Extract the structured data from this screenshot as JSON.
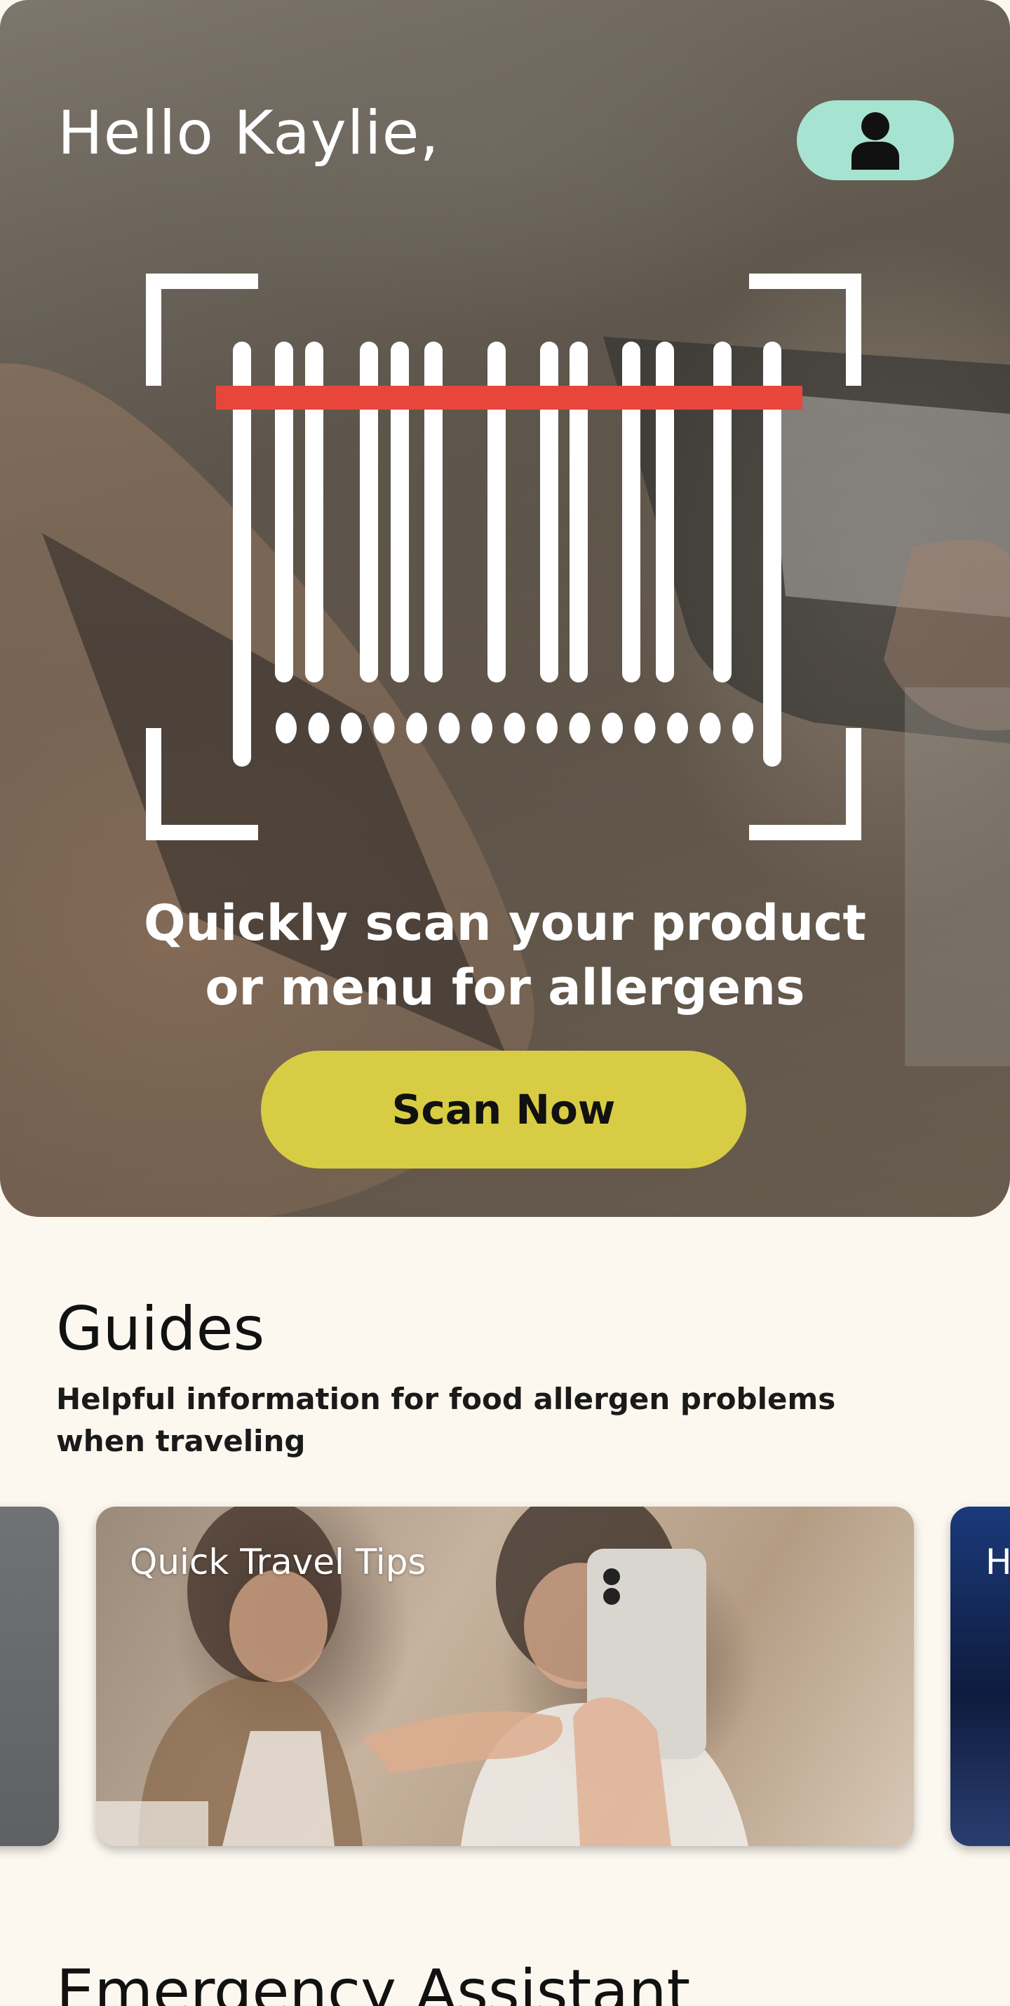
{
  "colors": {
    "background": "#FCF8F0",
    "profile_button": "#A7E3D1",
    "scan_button": "#D8CC44",
    "scan_line": "#E8463A",
    "text_dark": "#111111",
    "text_light": "#FFFFFF"
  },
  "header": {
    "greeting": "Hello Kaylie,",
    "profile_icon": "user-icon"
  },
  "hero": {
    "scanner_icon": "barcode-scanner-icon",
    "caption_line1": "Quickly scan your product",
    "caption_line2": "or menu for allergens",
    "scan_button_label": "Scan Now"
  },
  "guides": {
    "title": "Guides",
    "subtitle_line1": "Helpful information for food allergen problems",
    "subtitle_line2": "when traveling",
    "cards": [
      {
        "label": ""
      },
      {
        "label": "Quick Travel Tips"
      },
      {
        "label": "H"
      }
    ]
  },
  "emergency": {
    "title": "Emergency Assistant"
  }
}
